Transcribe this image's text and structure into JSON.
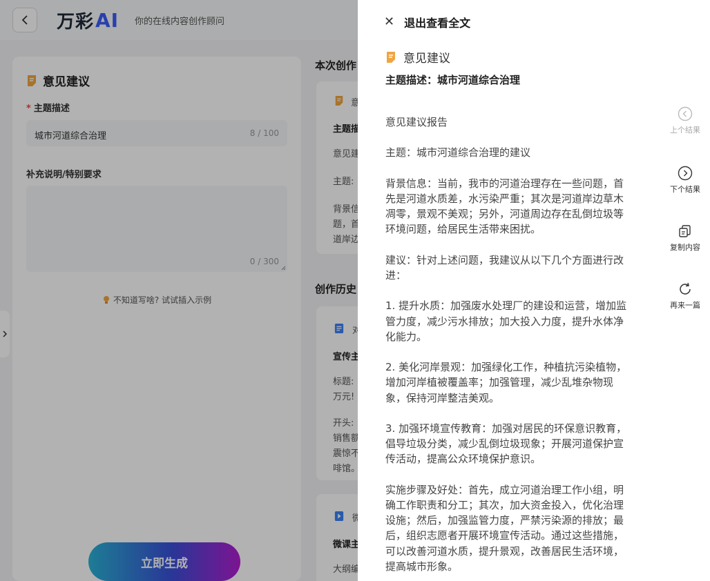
{
  "header": {
    "logo_text": "万彩",
    "logo_ai": "AI",
    "tagline": "你的在线内容创作顾问"
  },
  "form": {
    "card_title": "意见建议",
    "topic_label": "主题描述",
    "topic_value": "城市河道综合治理",
    "topic_counter": "8 / 100",
    "extra_label": "补充说明/特别要求",
    "extra_value": "",
    "extra_counter": "0 / 300",
    "hint": "不知道写啥? 试试插入示例",
    "generate_button": "立即生成"
  },
  "middle": {
    "current_heading": "本次创作",
    "current_card": {
      "title_fragment": "意",
      "topic_fragment": "主题描",
      "lines": [
        "意见建",
        "主题:",
        "背景信",
        "题，首",
        "道岸边"
      ]
    },
    "history_heading": "创作历史",
    "history_cards": [
      {
        "title_fragment": "对",
        "topic_fragment": "宣传主",
        "lines": [
          "标题:",
          "万元!",
          "开头:",
          "销售额",
          "震惊不",
          "啡馆。"
        ]
      },
      {
        "title_fragment": "微",
        "topic_fragment": "微课主",
        "lines": [
          "大纲编"
        ]
      }
    ]
  },
  "drawer": {
    "exit_label": "退出查看全文",
    "section_title": "意见建议",
    "topic_line": "主题描述：城市河道综合治理",
    "paragraphs": [
      "意见建议报告",
      "主题：城市河道综合治理的建议",
      "背景信息：当前，我市的河道治理存在一些问题，首先是河道水质差，水污染严重；其次是河道岸边草木凋零，景观不美观；另外，河道周边存在乱倒垃圾等环境问题，给居民生活带来困扰。",
      "建议：针对上述问题，我建议从以下几个方面进行改进：",
      "1. 提升水质：加强废水处理厂的建设和运营，增加监管力度，减少污水排放；加大投入力度，提升水体净化能力。",
      "2. 美化河岸景观：加强绿化工作，种植抗污染植物，增加河岸植被覆盖率；加强管理，减少乱堆杂物现象，保持河岸整洁美观。",
      "3. 加强环境宣传教育：加强对居民的环保意识教育，倡导垃圾分类，减少乱倒垃圾现象；开展河道保护宣传活动，提高公众环境保护意识。",
      "实施步骤及好处：首先，成立河道治理工作小组，明确工作职责和分工；其次，加大资金投入，优化治理设施；然后，加强监管力度，严禁污染源的排放；最后，组织志愿者开展环境宣传活动。通过这些措施，可以改善河道水质，提升景观，改善居民生活环境，提高城市形象。"
    ],
    "tools": {
      "prev": "上个结果",
      "next": "下个结果",
      "copy": "复制内容",
      "regen": "再来一篇"
    }
  },
  "colors": {
    "doc_icon": "#f0a541",
    "blue_icon": "#3b82f6",
    "required_star": "#e5484d",
    "button_gradient": [
      "#2ab3d6",
      "#3b4fd8",
      "#b31dd2"
    ]
  },
  "icons": [
    "back-arrow-icon",
    "document-icon",
    "lightbulb-icon",
    "chevron-right-icon",
    "close-icon",
    "arrow-left-circle-icon",
    "arrow-right-circle-icon",
    "copy-icon",
    "refresh-icon"
  ]
}
